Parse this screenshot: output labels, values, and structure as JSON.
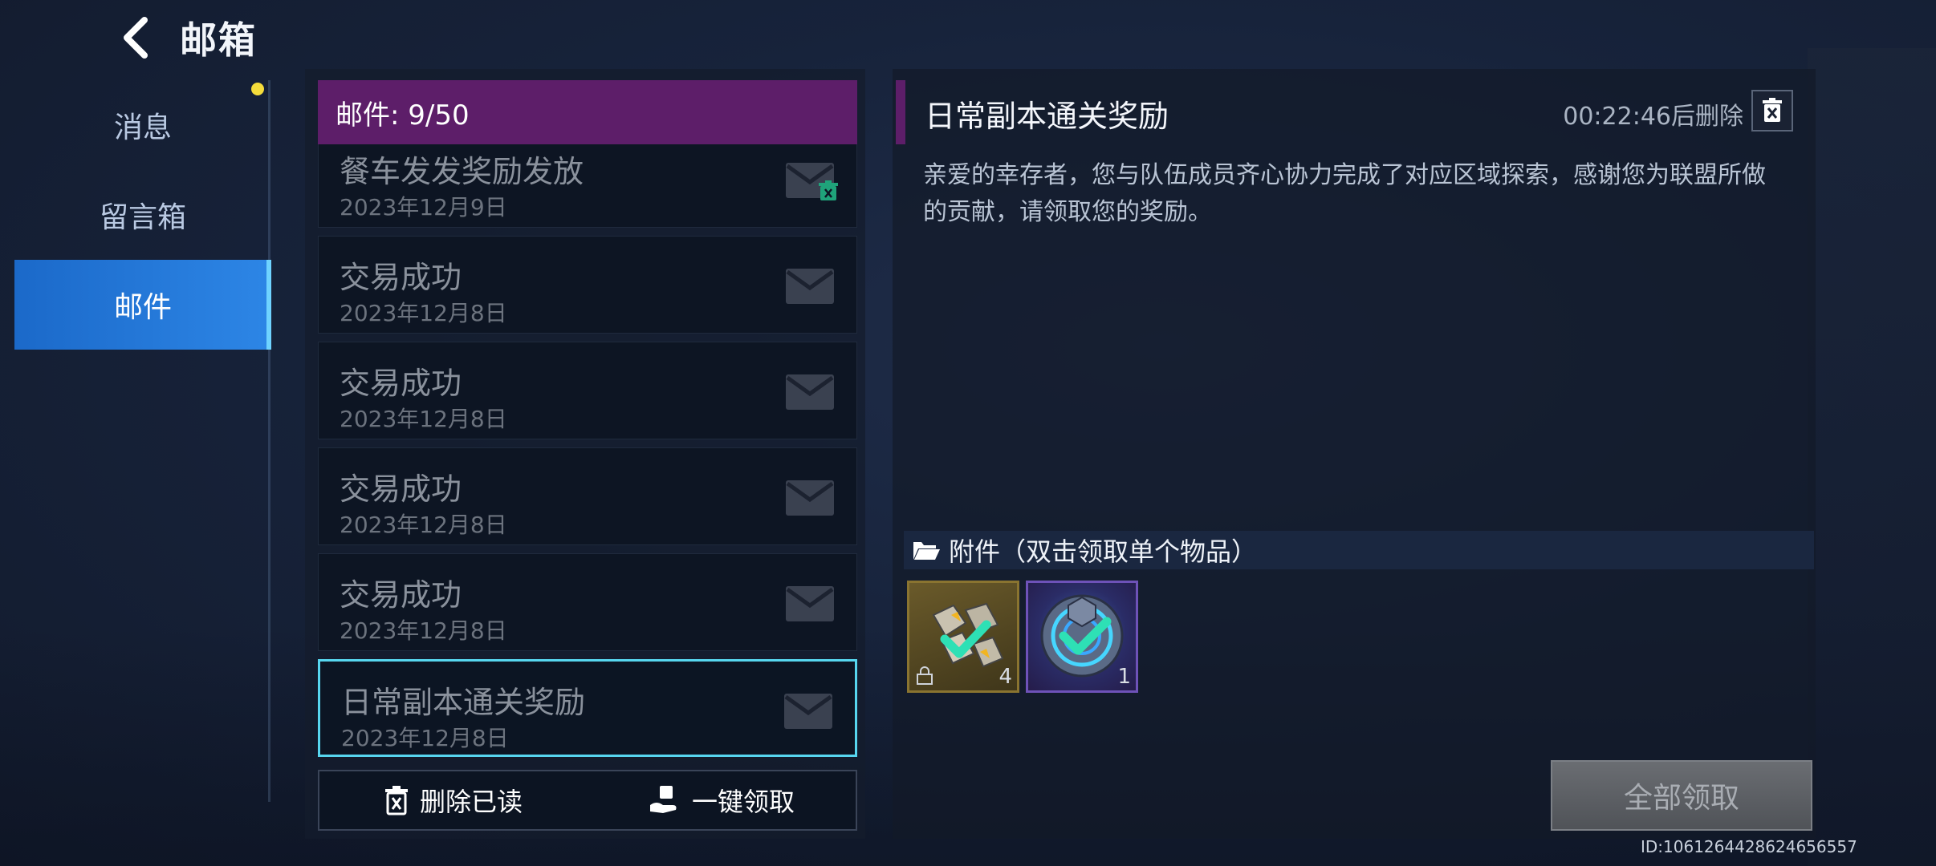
{
  "header": {
    "title": "邮箱"
  },
  "sidebar": {
    "items": [
      {
        "label": "消息"
      },
      {
        "label": "留言箱"
      },
      {
        "label": "邮件"
      }
    ]
  },
  "mail_list": {
    "count_label": "邮件: 9/50",
    "items": [
      {
        "title": "餐车发发奖励发放",
        "date": "2023年12月9日"
      },
      {
        "title": "交易成功",
        "date": "2023年12月8日"
      },
      {
        "title": "交易成功",
        "date": "2023年12月8日"
      },
      {
        "title": "交易成功",
        "date": "2023年12月8日"
      },
      {
        "title": "交易成功",
        "date": "2023年12月8日"
      },
      {
        "title": "日常副本通关奖励",
        "date": "2023年12月8日"
      }
    ],
    "delete_read_label": "删除已读",
    "claim_all_label": "一键领取"
  },
  "detail": {
    "title": "日常副本通关奖励",
    "countdown": "00:22:46后删除",
    "body": "亲爱的幸存者，您与队伍成员齐心协力完成了对应区域探索，感谢您为联盟所做的贡献，请领取您的奖励。",
    "attachment_label": "附件（双击领取单个物品）",
    "attachments": [
      {
        "count": "4",
        "claimed": true
      },
      {
        "count": "1",
        "claimed": true
      }
    ],
    "claim_all_button": "全部领取"
  },
  "footer": {
    "id": "ID:1061264428624656557"
  },
  "colors": {
    "accent_purple": "#5d1e69",
    "active_tab": "#2d86e6",
    "selected_border": "#57d6ef",
    "notify_dot": "#f4dc3b",
    "check": "#2ee0b5"
  }
}
